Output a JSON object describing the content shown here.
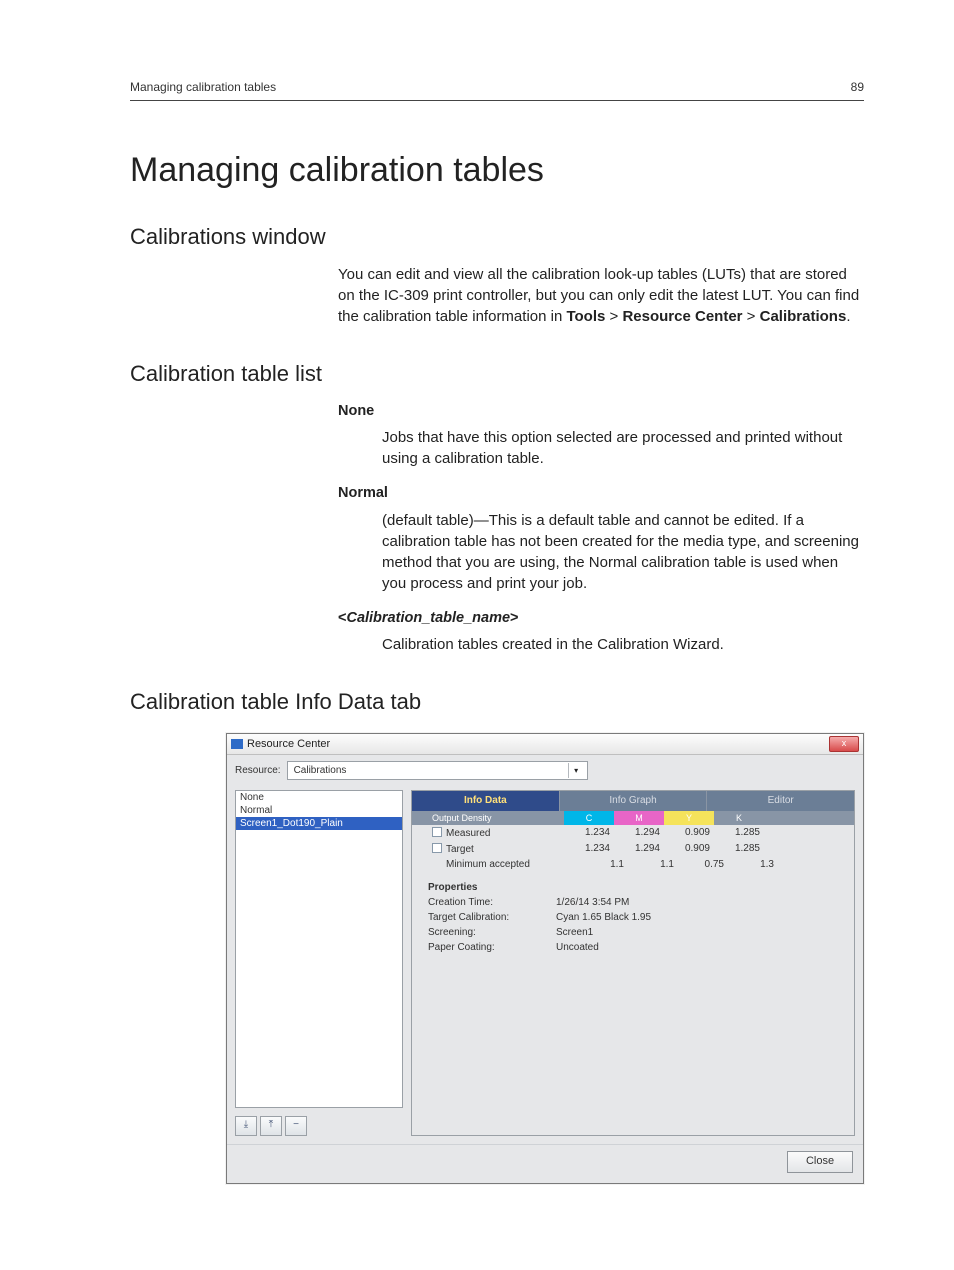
{
  "header": {
    "running_title": "Managing calibration tables",
    "page_number": "89"
  },
  "h1": "Managing calibration tables",
  "sec1": {
    "title": "Calibrations window",
    "para_a": "You can edit and view all the calibration look-up tables (LUTs) that are stored on the IC-309 print controller, but you can only edit the latest LUT. You can find the calibration table information in ",
    "tools": "Tools",
    "gt1": " > ",
    "rc": "Resource Center",
    "gt2": " > ",
    "cal": "Calibrations",
    "period": "."
  },
  "sec2": {
    "title": "Calibration table list",
    "none_term": "None",
    "none_def": "Jobs that have this option selected are processed and printed without using a calibration table.",
    "normal_term": "Normal",
    "normal_def": "(default table)—This is a default table and cannot be edited. If a calibration table has not been created for the media type, and screening method that you are using, the Normal calibration table is used when you process and print your job.",
    "ctn_open": "<",
    "ctn_name": "Calibration_table_name",
    "ctn_close": ">",
    "ctn_def": "Calibration tables created in the Calibration Wizard."
  },
  "sec3": {
    "title": "Calibration table Info Data tab"
  },
  "shot": {
    "window_title": "Resource Center",
    "close_x": "x",
    "resource_label": "Resource:",
    "resource_value": "Calibrations",
    "list": {
      "items": [
        "None",
        "Normal",
        "Screen1_Dot190_Plain"
      ],
      "selected_index": 2
    },
    "left_buttons": {
      "import": "⤓",
      "export": "⤒",
      "delete": "−"
    },
    "tabs": {
      "info_data": "Info Data",
      "info_graph": "Info Graph",
      "editor": "Editor",
      "active": 0
    },
    "density": {
      "label": "Output Density",
      "cols": {
        "c": "C",
        "m": "M",
        "y": "Y",
        "k": "K"
      },
      "rows": [
        {
          "label": "Measured",
          "c": "1.234",
          "m": "1.294",
          "y": "0.909",
          "k": "1.285"
        },
        {
          "label": "Target",
          "c": "1.234",
          "m": "1.294",
          "y": "0.909",
          "k": "1.285"
        },
        {
          "label": "Minimum accepted",
          "c": "1.1",
          "m": "1.1",
          "y": "0.75",
          "k": "1.3"
        }
      ]
    },
    "props": {
      "title": "Properties",
      "creation_time_k": "Creation Time:",
      "creation_time_v": "1/26/14 3:54 PM",
      "target_cal_k": "Target Calibration:",
      "target_cal_v": "Cyan 1.65  Black 1.95",
      "screening_k": "Screening:",
      "screening_v": "Screen1",
      "paper_k": "Paper Coating:",
      "paper_v": "Uncoated"
    },
    "footer_close": "Close"
  }
}
